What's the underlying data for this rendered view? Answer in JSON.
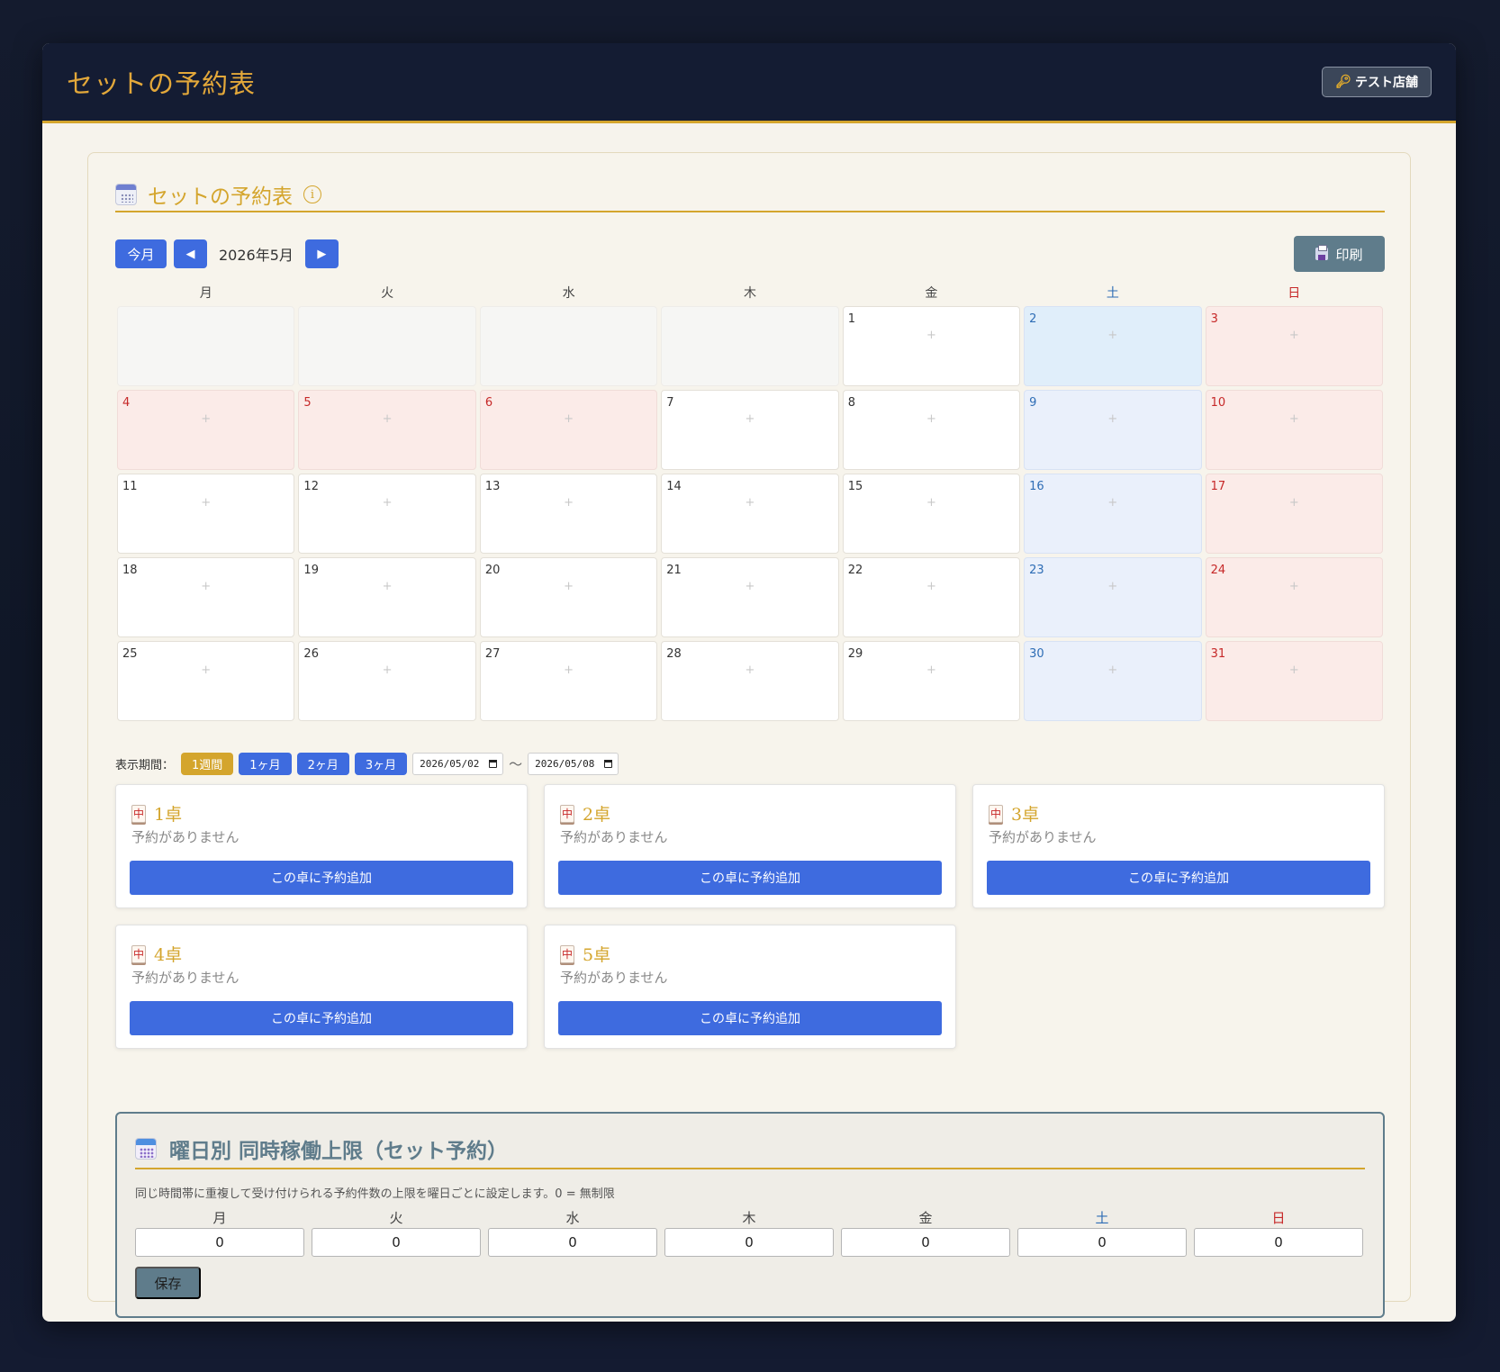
{
  "header": {
    "title": "セットの予約表",
    "store_button": "テスト店舗",
    "store_icon": "key-icon"
  },
  "section": {
    "title": "セットの予約表",
    "info_icon": "i"
  },
  "toolbar": {
    "today": "今月",
    "prev": "◀",
    "next": "▶",
    "month": "2026年5月",
    "print": "印刷"
  },
  "weekdays": [
    "月",
    "火",
    "水",
    "木",
    "金",
    "土",
    "日"
  ],
  "calendar": {
    "plus": "+",
    "cells": [
      {
        "day": ""
      },
      {
        "day": ""
      },
      {
        "day": ""
      },
      {
        "day": ""
      },
      {
        "day": "1"
      },
      {
        "day": "2",
        "type": "sat"
      },
      {
        "day": "3",
        "type": "sun"
      },
      {
        "day": "4",
        "type": "hol"
      },
      {
        "day": "5",
        "type": "hol"
      },
      {
        "day": "6",
        "type": "hol"
      },
      {
        "day": "7"
      },
      {
        "day": "8"
      },
      {
        "day": "9",
        "type": "sat"
      },
      {
        "day": "10",
        "type": "sun"
      },
      {
        "day": "11"
      },
      {
        "day": "12"
      },
      {
        "day": "13"
      },
      {
        "day": "14"
      },
      {
        "day": "15"
      },
      {
        "day": "16",
        "type": "sat"
      },
      {
        "day": "17",
        "type": "sun"
      },
      {
        "day": "18"
      },
      {
        "day": "19"
      },
      {
        "day": "20"
      },
      {
        "day": "21"
      },
      {
        "day": "22"
      },
      {
        "day": "23",
        "type": "sat"
      },
      {
        "day": "24",
        "type": "sun"
      },
      {
        "day": "25"
      },
      {
        "day": "26"
      },
      {
        "day": "27"
      },
      {
        "day": "28"
      },
      {
        "day": "29"
      },
      {
        "day": "30",
        "type": "sat"
      },
      {
        "day": "31",
        "type": "sun"
      }
    ]
  },
  "period": {
    "label": "表示期間：",
    "options": [
      "1週間",
      "1ヶ月",
      "2ヶ月",
      "3ヶ月"
    ],
    "active": "1週間",
    "from": "2026/05/02",
    "to": "2026/05/08",
    "separator": "〜"
  },
  "tables": [
    {
      "name": "1卓",
      "status": "予約がありません",
      "button": "この卓に予約追加"
    },
    {
      "name": "2卓",
      "status": "予約がありません",
      "button": "この卓に予約追加"
    },
    {
      "name": "3卓",
      "status": "予約がありません",
      "button": "この卓に予約追加"
    },
    {
      "name": "4卓",
      "status": "予約がありません",
      "button": "この卓に予約追加"
    },
    {
      "name": "5卓",
      "status": "予約がありません",
      "button": "この卓に予約追加"
    }
  ],
  "tile_glyph": "中",
  "limits": {
    "title": "曜日別 同時稼働上限（セット予約）",
    "description": "同じ時間帯に重複して受け付けられる予約件数の上限を曜日ごとに設定します。0 = 無制限",
    "values": [
      "0",
      "0",
      "0",
      "0",
      "0",
      "0",
      "0"
    ],
    "save": "保存"
  },
  "colors": {
    "accent_gold": "#d4a52d",
    "primary_blue": "#3e6bdf",
    "slate": "#5f7c8b",
    "header_bg": "#141c33",
    "saturday": "#2e6db5",
    "sunday": "#c62828"
  }
}
